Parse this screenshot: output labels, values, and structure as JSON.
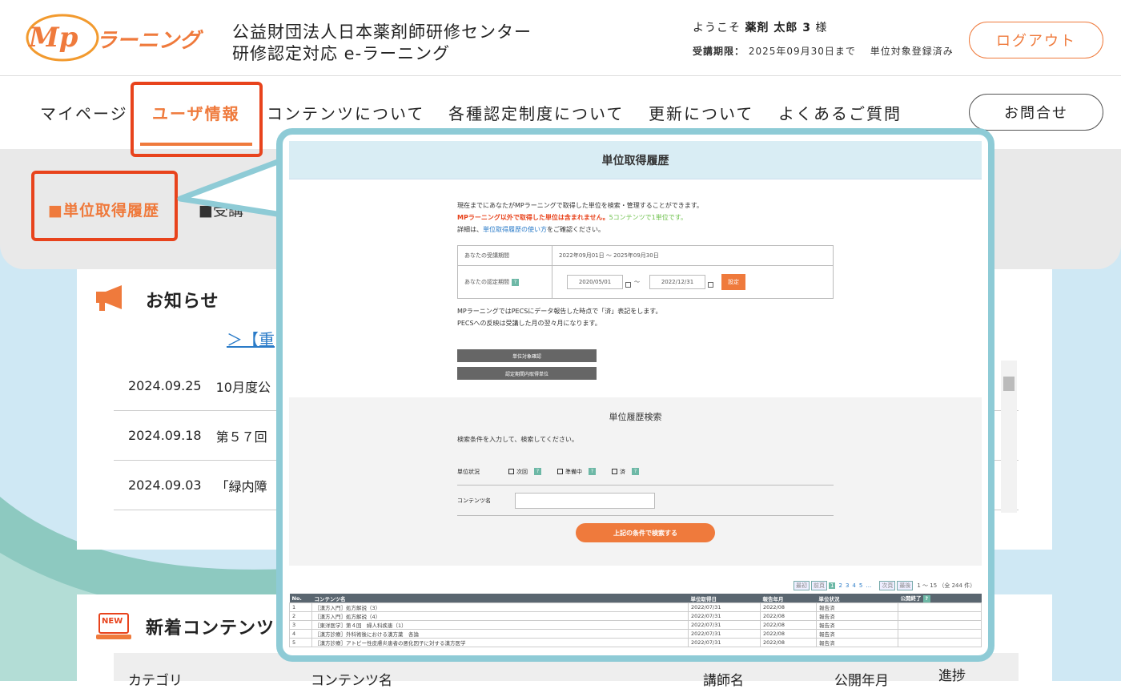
{
  "header": {
    "logo_text": "Mp ラーニング",
    "org_line1": "公益財団法人日本薬剤師研修センター",
    "org_line2": "研修認定対応 e-ラーニング",
    "welcome_prefix": "ようこそ",
    "user_name": "薬剤 太郎 3",
    "welcome_suffix": "様",
    "period_label": "受講期限：",
    "period_value": "2025年09月30日まで",
    "unit_status": "単位対象登録済み",
    "logout_label": "ログアウト"
  },
  "nav": {
    "items": [
      "マイページ",
      "ユーザ情報",
      "コンテンツについて",
      "各種認定制度について",
      "更新について",
      "よくあるご質問"
    ],
    "contact_label": "お問合せ"
  },
  "sub": {
    "active_link": "■単位取得履歴",
    "other_link": "■受講"
  },
  "notices": {
    "title": "お知らせ",
    "link_text": "＞【重",
    "rows": [
      {
        "date": "2024.09.25",
        "text": "10月度公"
      },
      {
        "date": "2024.09.18",
        "text": "第５７回"
      },
      {
        "date": "2024.09.03",
        "text": "「緑内障"
      }
    ]
  },
  "new_contents": {
    "badge": "NEW",
    "title": "新着コンテンツ",
    "headers": [
      "カテゴリ",
      "コンテンツ名",
      "講師名",
      "公開年月",
      "進捗"
    ]
  },
  "popup": {
    "title": "単位取得履歴",
    "intro1": "現在までにあなたがMPラーニングで取得した単位を検索・管理することができます。",
    "intro2_red": "MPラーニング以外で取得した単位は含まれません。",
    "intro2_green": "5コンテンツで1単位です。",
    "intro3_a": "詳細は、",
    "intro3_link": "単位取得履歴の使い方",
    "intro3_b": "をご確認ください。",
    "period_label": "あなたの受講期間",
    "period_value": "2022年09月01日 ～ 2025年09月30日",
    "cert_label": "あなたの認定期間",
    "date_from": "2020/05/01",
    "date_sep": "～",
    "date_to": "2022/12/31",
    "set_label": "設定",
    "note1": "MPラーニングではPECSにデータ報告した時点で「済」表記をします。",
    "note2": "PECSへの反映は受講した月の翌々月になります。",
    "btn1": "単位対象確認",
    "btn2": "認定期間内取得単位",
    "search_title": "単位履歴検索",
    "search_sub": "検索条件を入力して、検索してください。",
    "status_label": "単位状況",
    "status_opts": [
      "次回",
      "準備中",
      "済"
    ],
    "content_label": "コンテンツ名",
    "search_btn": "上記の条件で検索する",
    "pager": {
      "first": "最初",
      "prev": "前頁",
      "current": "1",
      "pages": [
        "2",
        "3",
        "4",
        "5",
        "…"
      ],
      "next": "次頁",
      "last": "最後",
      "summary": "1 ～ 15 （全 244 件）"
    },
    "table": {
      "headers": [
        "No.",
        "コンテンツ名",
        "単位取得日",
        "報告年月",
        "単位状況",
        "公開終了"
      ],
      "rows": [
        [
          "1",
          "［漢方入門］処方解説（3）",
          "2022/07/31",
          "2022/08",
          "報告済",
          ""
        ],
        [
          "2",
          "［漢方入門］処方解説（4）",
          "2022/07/31",
          "2022/08",
          "報告済",
          ""
        ],
        [
          "3",
          "［東洋医学］第４回　婦人科疾患（1）",
          "2022/07/31",
          "2022/08",
          "報告済",
          ""
        ],
        [
          "4",
          "［漢方診療］外科術後における漢方薬　各論",
          "2022/07/31",
          "2022/08",
          "報告済",
          ""
        ],
        [
          "5",
          "［漢方診療］アトピー性皮膚炎患者の悪化因子に対する漢方医学",
          "2022/07/31",
          "2022/08",
          "報告済",
          ""
        ]
      ]
    }
  },
  "colors": {
    "accent": "#ef7a3c",
    "highlight": "#e8431c",
    "popup_border": "#8ecbd6"
  }
}
